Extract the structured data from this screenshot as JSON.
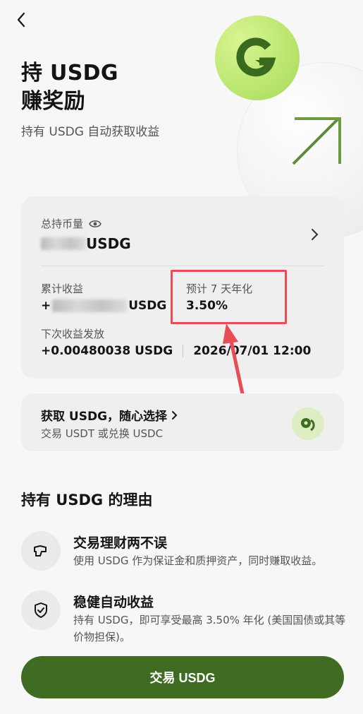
{
  "hero": {
    "title_line1": "持 USDG",
    "title_line2": "赚奖励",
    "subtitle": "持有 USDG 自动获取收益"
  },
  "holdings": {
    "total_label": "总持币量",
    "total_unit": "USDG",
    "accumulated_label": "累计收益",
    "accumulated_prefix": "+",
    "accumulated_unit": "USDG",
    "apy_label": "预计 7 天年化",
    "apy_value": "3.50%",
    "next_payout_label": "下次收益发放",
    "next_payout_amount": "+0.00480038 USDG",
    "next_payout_time": "2026/07/01 12:00"
  },
  "get_usdg": {
    "title": "获取 USDG，随心选择",
    "subtitle": "交易 USDT 或兑换 USDC"
  },
  "reasons": {
    "title": "持有 USDG 的理由",
    "items": [
      {
        "title": "交易理财两不误",
        "desc": "使用 USDG 作为保证金和质押资产，同时赚取收益。",
        "icon": "handshake-icon"
      },
      {
        "title": "稳健自动收益",
        "desc": "持有 USDG，即可享受最高 3.50% 年化 (美国国债或其等价物担保)。",
        "icon": "shield-check-icon"
      }
    ]
  },
  "cta": {
    "label": "交易 USDG"
  },
  "colors": {
    "brand_green": "#3f6b22",
    "accent_lime": "#b5e36a",
    "annotation_red": "#e84c55"
  }
}
